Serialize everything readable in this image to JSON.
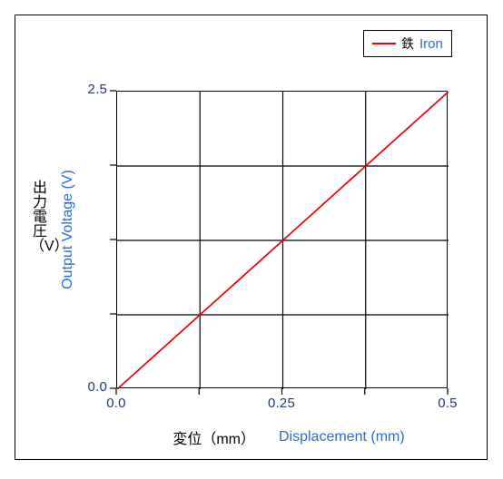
{
  "chart_data": {
    "type": "line",
    "title": "",
    "xlabel": "変位（mm）",
    "xlabel_en": "Displacement (mm)",
    "ylabel": "出力電圧（V）",
    "ylabel_en": "Output Voltage (V)",
    "xlim": [
      0.0,
      0.5
    ],
    "ylim": [
      0.0,
      2.5
    ],
    "xticks": [
      "0.0",
      "0.25",
      "0.5"
    ],
    "xtick_values": [
      0.0,
      0.25,
      0.5
    ],
    "yticks": [
      "0.0",
      "2.5"
    ],
    "ytick_values": [
      0.0,
      2.5
    ],
    "grid": true,
    "grid_x_values": [
      0.0,
      0.125,
      0.25,
      0.375,
      0.5
    ],
    "grid_y_values": [
      0.0,
      0.625,
      1.25,
      1.875,
      2.5
    ],
    "legend_position": "top-right",
    "series": [
      {
        "name": "鉄",
        "name_en": "Iron",
        "color": "#e8000b",
        "x": [
          0.0,
          0.125,
          0.25,
          0.375,
          0.5
        ],
        "values": [
          0.0,
          0.625,
          1.25,
          1.875,
          2.5
        ]
      }
    ]
  },
  "axes": {
    "y_label_jp_chars": [
      "出",
      "力",
      "電",
      "圧",
      "（V）"
    ],
    "y_label_en": "Output Voltage (V)",
    "y_tick_top": "2.5",
    "y_tick_bottom": "0.0",
    "x_tick_left": "0.0",
    "x_tick_mid": "0.25",
    "x_tick_right": "0.5",
    "x_label_jp": "変位（mm）",
    "x_label_en": "Displacement (mm)"
  },
  "legend": {
    "entry_jp": "鉄",
    "entry_en": "Iron",
    "line_color": "#e8000b"
  },
  "colors": {
    "line": "#e8000b",
    "english_text": "#2b6cd4",
    "tick_text": "#1f3b73",
    "japanese_text": "#000000",
    "axis": "#000000",
    "background": "#ffffff"
  }
}
